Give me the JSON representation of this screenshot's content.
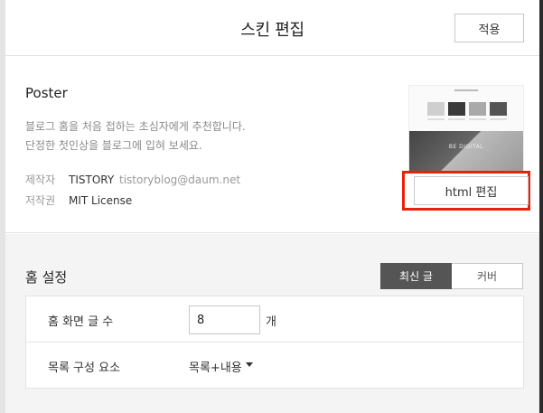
{
  "header": {
    "title": "스킨 편집",
    "apply_label": "적용"
  },
  "skin": {
    "name": "Poster",
    "description_line1": "블로그 홈을 처음 접하는 초심자에게 추천합니다.",
    "description_line2": "단정한 첫인상을 블로그에 입혀 보세요.",
    "maker_label": "제작자",
    "maker_name": "TISTORY",
    "maker_email": "tistoryblog@daum.net",
    "license_label": "저작권",
    "license_value": "MIT License",
    "thumbnail_text": "BE DIGITAL",
    "html_edit_label": "html 편집"
  },
  "home_settings": {
    "title": "홈 설정",
    "toggle": {
      "options": [
        "최신 글",
        "커버"
      ],
      "selected": "최신 글"
    },
    "post_count_label": "홈 화면 글 수",
    "post_count_value": "8",
    "post_count_unit": "개",
    "list_composition_label": "목록 구성 요소",
    "list_composition_value": "목록+내용"
  },
  "colors": {
    "highlight": "#e8210e",
    "toggle_active": "#555555",
    "background": "#f4f4f4"
  }
}
